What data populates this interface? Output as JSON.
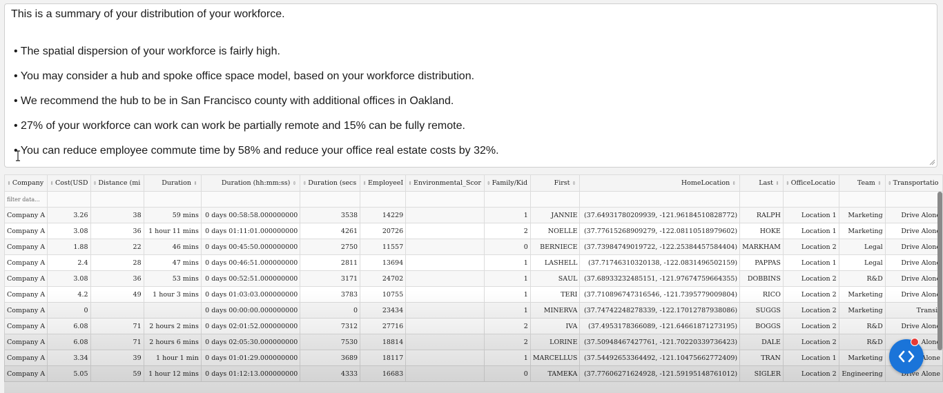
{
  "summary": {
    "intro": "This is a summary of your distribution of your workforce.",
    "bullets": [
      "• The spatial dispersion of your workforce is fairly high.",
      "• You may consider a hub and spoke office space model, based on your workforce distribution.",
      "• We recommend the hub to be in San Francisco county with additional offices in Oakland.",
      "• 27% of your workforce can work can work be partially remote and 15% can be fully remote.",
      "• You can reduce employee commute time by 58% and reduce your office real estate costs by 32%."
    ]
  },
  "table": {
    "columns": [
      "Company",
      "Cost(USD",
      "Distance (mi",
      "Duration",
      "Duration (hh:mm:ss)",
      "Duration (secs",
      "EmployeeI",
      "Environmental_Scor",
      "Family/Kid",
      "First",
      "HomeLocation",
      "Last",
      "OfficeLocatio",
      "Team",
      "Transportatio"
    ],
    "filter_placeholder": "filter data...",
    "rows": [
      [
        "Company A",
        "3.26",
        "38",
        "59 mins",
        "0 days 00:58:58.000000000",
        "3538",
        "14229",
        "",
        "1",
        "JANNIE",
        "(37.64931780209939, -121.96184510828772)",
        "RALPH",
        "Location 1",
        "Marketing",
        "Drive Alone"
      ],
      [
        "Company A",
        "3.08",
        "36",
        "1 hour 11 mins",
        "0 days 01:11:01.000000000",
        "4261",
        "20726",
        "",
        "2",
        "NOELLE",
        "(37.77615268909279, -122.08110518979602)",
        "HOKE",
        "Location 1",
        "Marketing",
        "Drive Alone"
      ],
      [
        "Company A",
        "1.88",
        "22",
        "46 mins",
        "0 days 00:45:50.000000000",
        "2750",
        "11557",
        "",
        "0",
        "BERNIECE",
        "(37.73984749019722, -122.25384457584404)",
        "MARKHAM",
        "Location 2",
        "Legal",
        "Drive Alone"
      ],
      [
        "Company A",
        "2.4",
        "28",
        "47 mins",
        "0 days 00:46:51.000000000",
        "2811",
        "13694",
        "",
        "1",
        "LASHELL",
        "(37.71746310320138, -122.0831496502159)",
        "PAPPAS",
        "Location 1",
        "Legal",
        "Drive Alone"
      ],
      [
        "Company A",
        "3.08",
        "36",
        "53 mins",
        "0 days 00:52:51.000000000",
        "3171",
        "24702",
        "",
        "1",
        "SAUL",
        "(37.68933232485151, -121.97674759664355)",
        "DOBBINS",
        "Location 2",
        "R&D",
        "Drive Alone"
      ],
      [
        "Company A",
        "4.2",
        "49",
        "1 hour 3 mins",
        "0 days 01:03:03.000000000",
        "3783",
        "10755",
        "",
        "1",
        "TERI",
        "(37.710896747316546, -121.7395779009804)",
        "RICO",
        "Location 2",
        "Marketing",
        "Drive Alone"
      ],
      [
        "Company A",
        "0",
        "",
        "",
        "0 days 00:00:00.000000000",
        "0",
        "23434",
        "",
        "1",
        "MINERVA",
        "(37.74742248278339, -122.17012787938086)",
        "SUGGS",
        "Location 2",
        "Marketing",
        "Transit"
      ],
      [
        "Company A",
        "6.08",
        "71",
        "2 hours 2 mins",
        "0 days 02:01:52.000000000",
        "7312",
        "27716",
        "",
        "2",
        "IVA",
        "(37.4953178366089, -121.64661871273195)",
        "BOGGS",
        "Location 2",
        "R&D",
        "Drive Alone"
      ],
      [
        "Company A",
        "6.08",
        "71",
        "2 hours 6 mins",
        "0 days 02:05:30.000000000",
        "7530",
        "18814",
        "",
        "2",
        "LORINE",
        "(37.50948467427761, -121.70220339736423)",
        "DALE",
        "Location 2",
        "R&D",
        "Alone"
      ],
      [
        "Company A",
        "3.34",
        "39",
        "1 hour 1 min",
        "0 days 01:01:29.000000000",
        "3689",
        "18117",
        "",
        "1",
        "MARCELLUS",
        "(37.54492653364492, -121.10475662772409)",
        "TRAN",
        "Location 1",
        "Marketing",
        "Alone"
      ],
      [
        "Company A",
        "5.05",
        "59",
        "1 hour 12 mins",
        "0 days 01:12:13.000000000",
        "4333",
        "16683",
        "",
        "0",
        "TAMEKA",
        "(37.77606271624928, -121.59195148761012)",
        "SIGLER",
        "Location 2",
        "Engineering",
        "Drive Alone"
      ]
    ]
  },
  "colors": {
    "fab": "#1a74d9",
    "badge": "#e53935"
  },
  "icons": {
    "fab": "code-icon",
    "sort": "sort-icon"
  }
}
